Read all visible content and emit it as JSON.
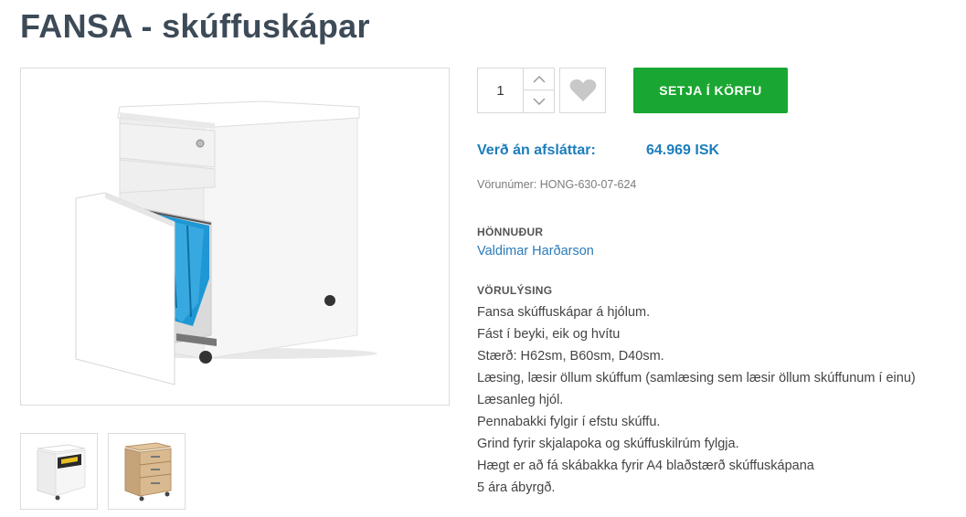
{
  "product": {
    "title": "FANSA - skúffuskápar",
    "quantity": "1",
    "add_to_cart_label": "SETJA Í KÖRFU",
    "price_label": "Verð án afsláttar:",
    "price_value": "64.969 ISK",
    "sku": "Vörunúmer: HONG-630-07-624",
    "designer_heading": "HÖNNUÐUR",
    "designer_name": "Valdimar Harðarson",
    "description_heading": "VÖRULÝSING",
    "description_lines": [
      "Fansa skúffuskápar á hjólum.",
      "Fást í beyki, eik og hvítu",
      "Stærð: H62sm, B60sm, D40sm.",
      "Læsing, læsir öllum skúffum (samlæsing sem læsir öllum skúffunum í einu)",
      "Læsanleg hjól.",
      "Pennabakki fylgir í efstu skúffu.",
      "Grind fyrir skjalapoka og skúffuskilrúm fylgja.",
      "Hægt er að fá skábakka fyrir A4 blaðstærð skúffuskápana",
      "5 ára ábyrgð."
    ]
  },
  "icons": {
    "increment": "chevron-up-icon",
    "decrement": "chevron-down-icon",
    "wishlist": "heart-icon"
  },
  "colors": {
    "title": "#3d4a57",
    "accent_blue": "#1c7dbd",
    "cart_green": "#1aa632",
    "border": "#dcdcdc"
  }
}
